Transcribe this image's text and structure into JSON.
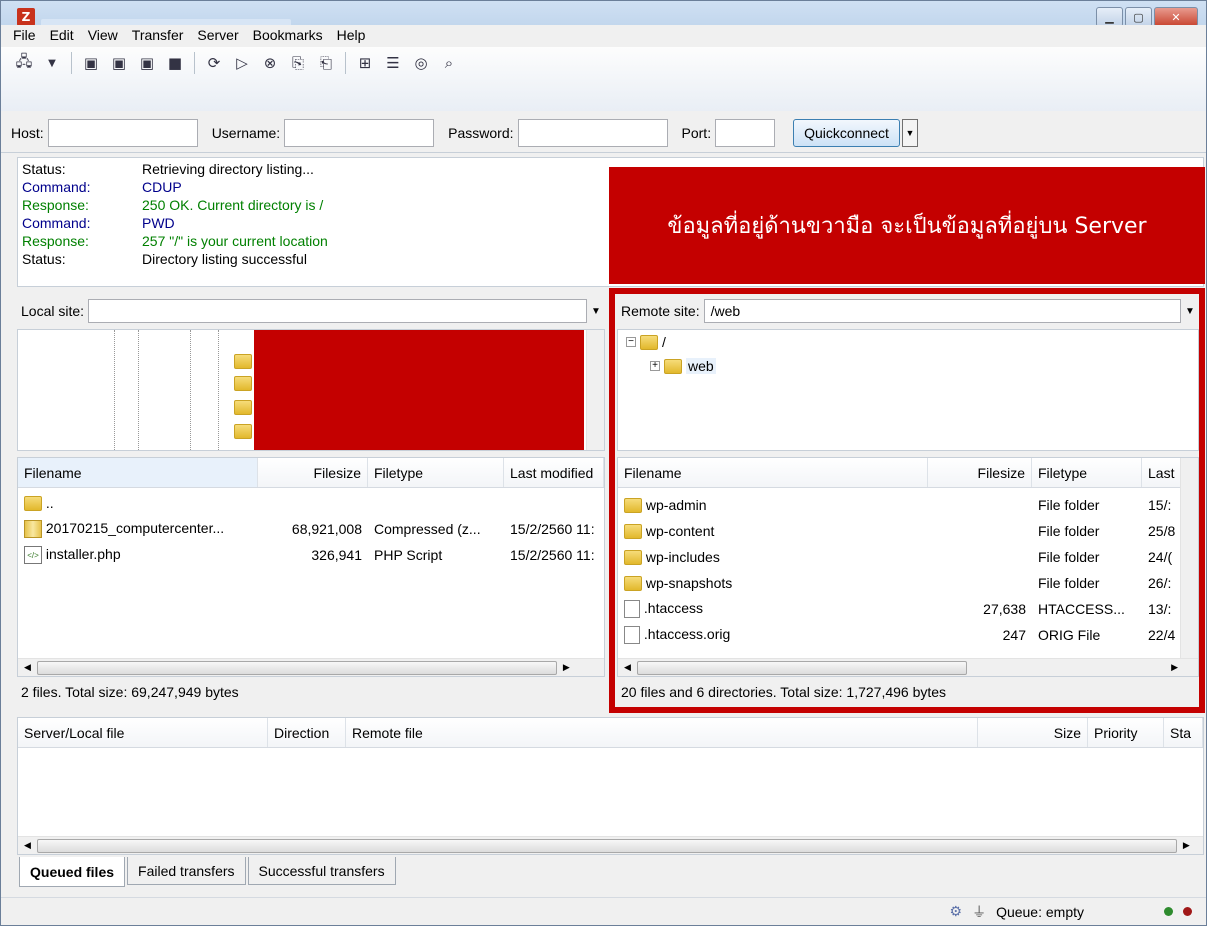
{
  "menu": [
    "File",
    "Edit",
    "View",
    "Transfer",
    "Server",
    "Bookmarks",
    "Help"
  ],
  "quickconnect": {
    "host_label": "Host:",
    "username_label": "Username:",
    "password_label": "Password:",
    "port_label": "Port:",
    "button": "Quickconnect"
  },
  "log": [
    {
      "k": "Status:",
      "v": "Retrieving directory listing...",
      "t": "status"
    },
    {
      "k": "Command:",
      "v": "CDUP",
      "t": "command"
    },
    {
      "k": "Response:",
      "v": "250 OK. Current directory is /",
      "t": "response"
    },
    {
      "k": "Command:",
      "v": "PWD",
      "t": "command"
    },
    {
      "k": "Response:",
      "v": "257 \"/\" is your current location",
      "t": "response"
    },
    {
      "k": "Status:",
      "v": "Directory listing successful",
      "t": "status"
    }
  ],
  "banner": "ข้อมูลที่อยู่ด้านขวามือ จะเป็นข้อมูลที่อยู่บน Server",
  "local": {
    "site_label": "Local site:",
    "headers": [
      "Filename",
      "Filesize",
      "Filetype",
      "Last modified"
    ],
    "rows": [
      {
        "name": "..",
        "size": "",
        "type": "",
        "mod": "",
        "icon": "folder"
      },
      {
        "name": "20170215_computercenter...",
        "size": "68,921,008",
        "type": "Compressed (z...",
        "mod": "15/2/2560 11:",
        "icon": "zip"
      },
      {
        "name": "installer.php",
        "size": "326,941",
        "type": "PHP Script",
        "mod": "15/2/2560 11:",
        "icon": "php"
      }
    ],
    "status": "2 files. Total size: 69,247,949 bytes"
  },
  "remote": {
    "site_label": "Remote site:",
    "path": "/web",
    "tree": [
      {
        "label": "/"
      },
      {
        "label": "web"
      }
    ],
    "headers": [
      "Filename",
      "Filesize",
      "Filetype",
      "Last"
    ],
    "rows": [
      {
        "name": "wp-admin",
        "size": "",
        "type": "File folder",
        "mod": "15/:",
        "icon": "folder"
      },
      {
        "name": "wp-content",
        "size": "",
        "type": "File folder",
        "mod": "25/8",
        "icon": "folder"
      },
      {
        "name": "wp-includes",
        "size": "",
        "type": "File folder",
        "mod": "24/(",
        "icon": "folder"
      },
      {
        "name": "wp-snapshots",
        "size": "",
        "type": "File folder",
        "mod": "26/:",
        "icon": "folder"
      },
      {
        "name": ".htaccess",
        "size": "27,638",
        "type": "HTACCESS...",
        "mod": "13/:",
        "icon": "file"
      },
      {
        "name": ".htaccess.orig",
        "size": "247",
        "type": "ORIG File",
        "mod": "22/4",
        "icon": "file"
      }
    ],
    "status": "20 files and 6 directories. Total size: 1,727,496 bytes"
  },
  "queue": {
    "headers": [
      "Server/Local file",
      "Direction",
      "Remote file",
      "Size",
      "Priority",
      "Sta"
    ]
  },
  "tabs": [
    "Queued files",
    "Failed transfers",
    "Successful transfers"
  ],
  "footer": {
    "queue": "Queue: empty"
  },
  "colors": {
    "highlight": "#c40000",
    "led_on": "#2e8b2e",
    "led_off": "#a01818"
  }
}
